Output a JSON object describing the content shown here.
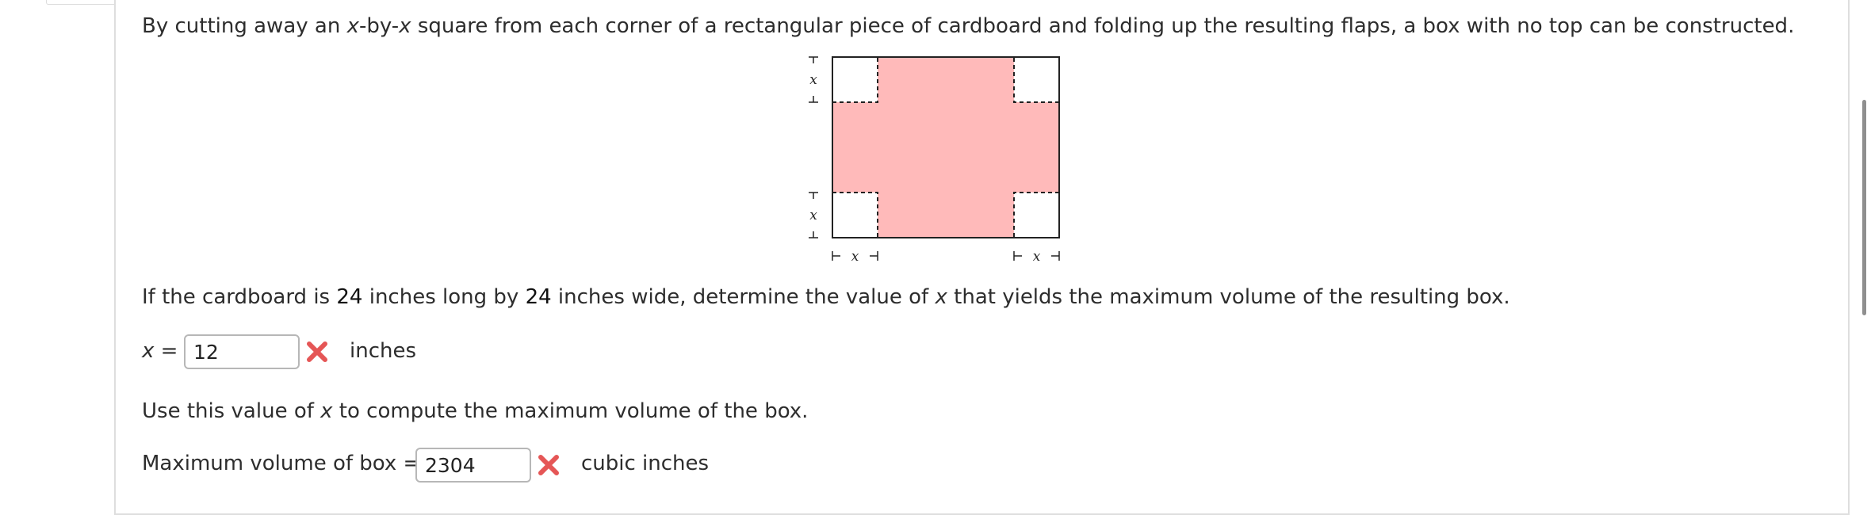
{
  "problem": {
    "intro_before": "By cutting away an ",
    "var1": "x",
    "intro_mid": "-by-",
    "var2": "x",
    "intro_after": " square from each corner of a rectangular piece of cardboard and folding up the resulting flaps, a box with no top can be constructed.",
    "q_part1": "If the cardboard is ",
    "length": "24",
    "q_part2": " inches long by ",
    "width": "24",
    "q_part3": " inches wide, determine the value of ",
    "q_var": "x",
    "q_part4": " that yields the maximum volume of the resulting box.",
    "use_part1": "Use this value of ",
    "use_var": "x",
    "use_part2": " to compute the maximum volume of the box."
  },
  "diagram": {
    "var_label": "x",
    "flap_color": "#ffbaba"
  },
  "answer_x": {
    "var": "x",
    "equals": " =",
    "value": "12",
    "unit": "inches",
    "status": "incorrect"
  },
  "answer_volume": {
    "label": "Maximum volume of box =",
    "value": "2304",
    "unit": "cubic inches",
    "status": "incorrect"
  },
  "colors": {
    "incorrect_mark": "#e55656",
    "input_border": "#b7b7b7",
    "text": "#2d2d2d"
  }
}
